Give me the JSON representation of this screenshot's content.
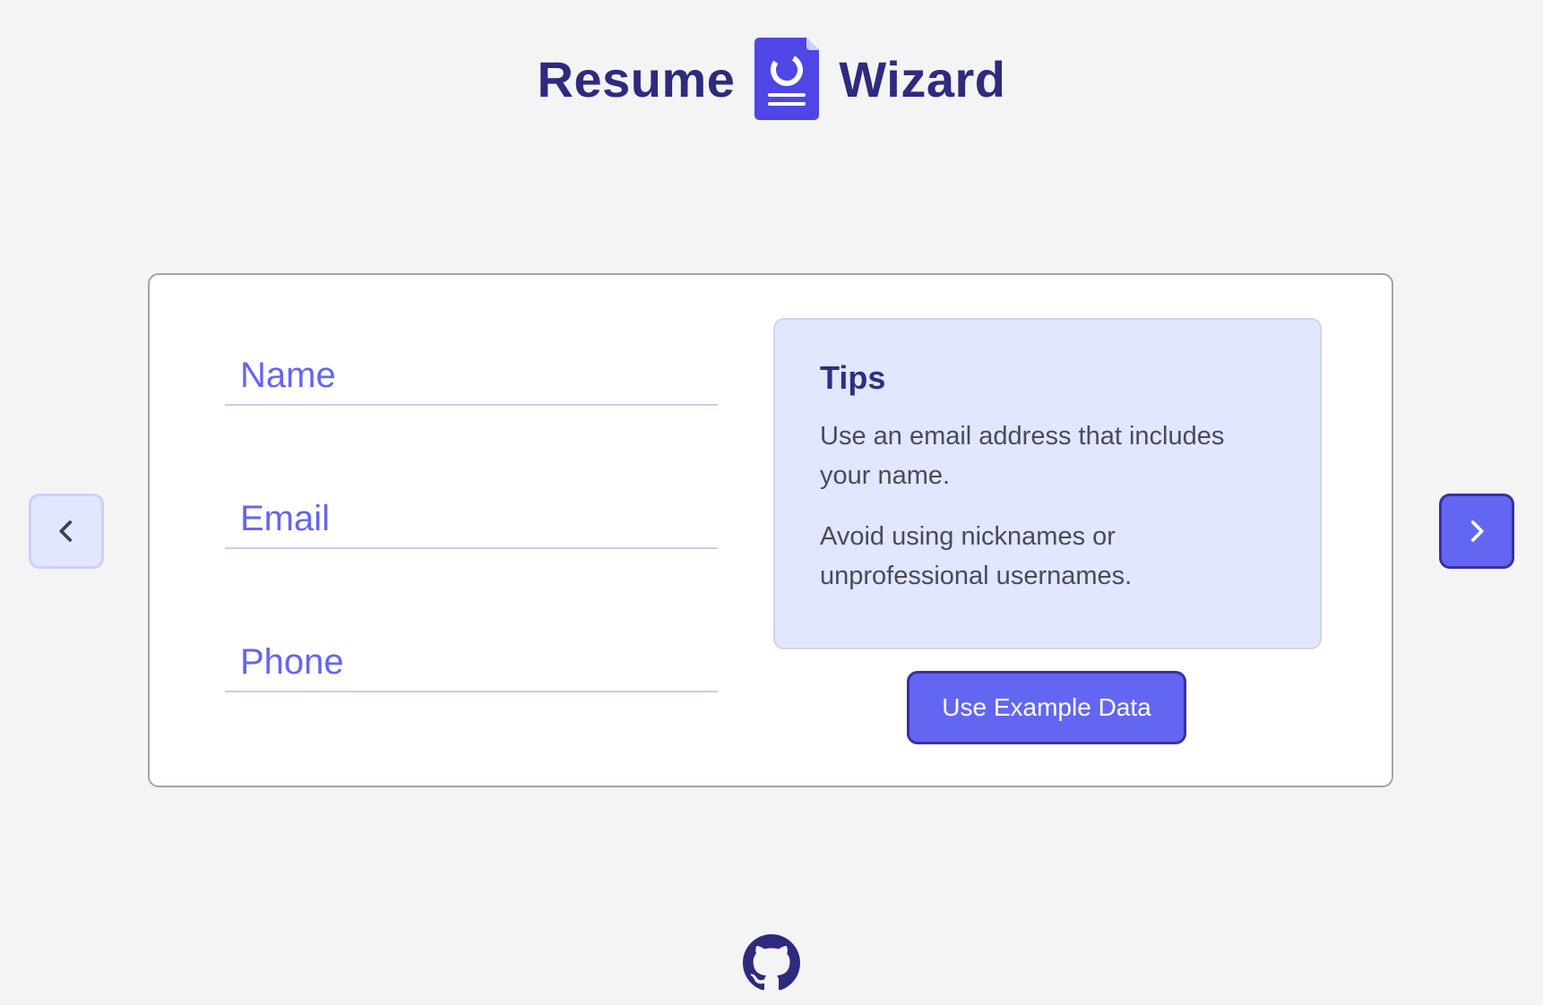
{
  "app": {
    "title_left": "Resume",
    "title_right": "Wizard",
    "logo_icon": "document-icon"
  },
  "form": {
    "fields": [
      {
        "name": "name",
        "placeholder": "Name",
        "value": ""
      },
      {
        "name": "email",
        "placeholder": "Email",
        "value": ""
      },
      {
        "name": "phone",
        "placeholder": "Phone",
        "value": ""
      }
    ]
  },
  "tips": {
    "title": "Tips",
    "items": [
      "Use an email address that includes your name.",
      "Avoid using nicknames or unprofessional usernames."
    ]
  },
  "actions": {
    "example_data_label": "Use Example Data",
    "prev_icon": "chevron-left-icon",
    "next_icon": "chevron-right-icon"
  },
  "footer": {
    "github_icon": "github-icon"
  },
  "colors": {
    "primary": "#6366f1",
    "primary_dark": "#2e2a7e",
    "tips_bg": "#e0e7ff",
    "background": "#f4f4f4"
  }
}
